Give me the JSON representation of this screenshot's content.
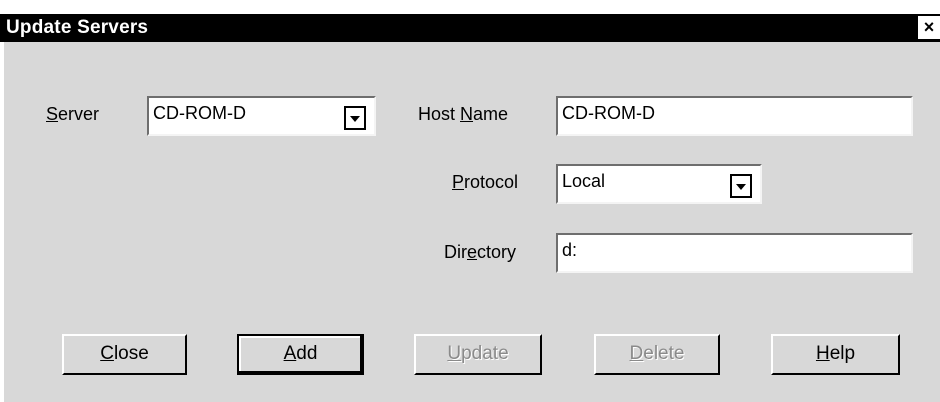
{
  "window": {
    "title": "Update Servers",
    "close_glyph": "×"
  },
  "fields": {
    "server": {
      "label_mnemonic": "S",
      "label_rest": "erver",
      "value": "CD-ROM-D"
    },
    "host_name": {
      "label_pre": "Host ",
      "label_mnemonic": "N",
      "label_rest": "ame",
      "value": "CD-ROM-D"
    },
    "protocol": {
      "label_mnemonic": "P",
      "label_rest": "rotocol",
      "value": "Local"
    },
    "directory": {
      "label_pre": "Dir",
      "label_mnemonic": "e",
      "label_rest": "ctory",
      "value": "d:"
    }
  },
  "buttons": {
    "close": {
      "mnemonic": "C",
      "rest": "lose",
      "enabled": true
    },
    "add": {
      "mnemonic": "A",
      "rest": "dd",
      "enabled": true,
      "default": true
    },
    "update": {
      "mnemonic": "U",
      "rest": "pdate",
      "enabled": false
    },
    "delete": {
      "mnemonic": "D",
      "rest": "elete",
      "enabled": false
    },
    "help": {
      "mnemonic": "H",
      "rest": "elp",
      "enabled": true
    }
  },
  "colors": {
    "titlebar": "#000000",
    "dialog_face": "#d8d8d8",
    "disabled_text": "#8a8a8a"
  },
  "icons": {
    "close": "close-icon",
    "dropdown": "chevron-down-icon"
  }
}
